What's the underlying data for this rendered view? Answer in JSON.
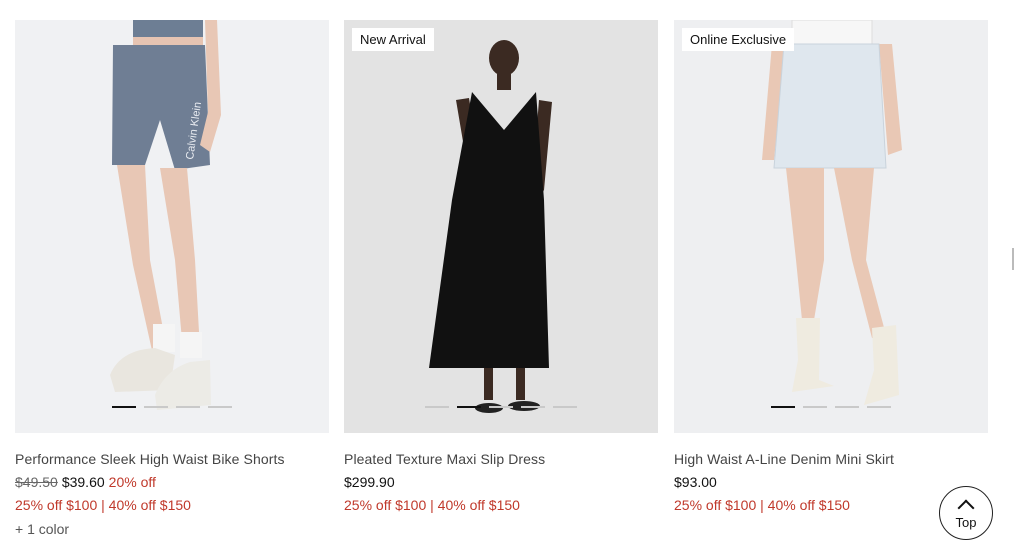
{
  "products": [
    {
      "badge": "",
      "title": "Performance Sleek High Waist Bike Shorts",
      "original_price": "$49.50",
      "sale_price": "$39.60",
      "discount": "20% off",
      "promo": "25% off $100 | 40% off $150",
      "colors": "+ 1 color",
      "carousel": {
        "count": 4,
        "active": 1
      }
    },
    {
      "badge": "New Arrival",
      "title": "Pleated Texture Maxi Slip Dress",
      "price": "$299.90",
      "promo": "25% off $100 | 40% off $150",
      "carousel": {
        "count": 5,
        "active": 2
      }
    },
    {
      "badge": "Online Exclusive",
      "title": "High Waist A-Line Denim Mini Skirt",
      "price": "$93.00",
      "promo": "25% off $100 | 40% off $150",
      "carousel": {
        "count": 4,
        "active": 1
      }
    }
  ],
  "top_button": {
    "label": "Top",
    "icon": "chevron-up-icon"
  },
  "colors": {
    "promo_red": "#c0392b",
    "text": "#444444"
  }
}
